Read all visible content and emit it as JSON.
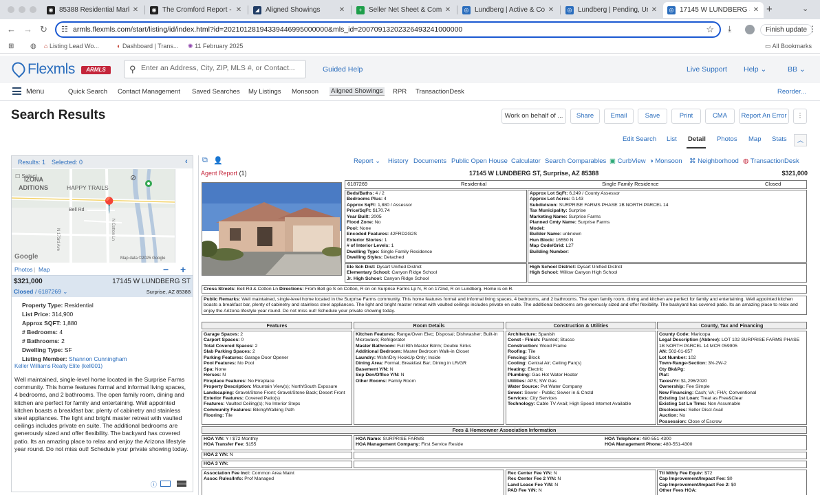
{
  "browser": {
    "tabs": [
      {
        "label": "85388 Residential Market",
        "fav_color": "#222222",
        "fav_glyph": "◉"
      },
      {
        "label": "The Cromford Report - Cro",
        "fav_color": "#222222",
        "fav_glyph": "◉"
      },
      {
        "label": "Aligned Showings",
        "fav_color": "#1f3b64",
        "fav_glyph": "◢"
      },
      {
        "label": "Seller Net Sheet & Compa",
        "fav_color": "#1e9e4a",
        "fav_glyph": "+"
      },
      {
        "label": "Lundberg | Active & Comi",
        "fav_color": "#2a6dbd",
        "fav_glyph": "◎"
      },
      {
        "label": "Lundberg | Pending, Unde",
        "fav_color": "#2a6dbd",
        "fav_glyph": "◎"
      },
      {
        "label": "17145 W LUNDBERG ST, S",
        "fav_color": "#2a6dbd",
        "fav_glyph": "◎"
      }
    ],
    "url": "armls.flexmls.com/start/listing/id/index.html?id=20210128194339446995000000&mls_id=20070913202326493241000000",
    "finish_update": "Finish update",
    "bookmarks": [
      "Listing Lead Wo...",
      "Dashboard | Trans...",
      "11 February 2025"
    ],
    "all_bookmarks": "All Bookmarks"
  },
  "app": {
    "logo": "Flexmls",
    "badge": "ARMLS",
    "search_placeholder": "Enter an Address, City, ZIP, MLS #, or Contact...",
    "guided_help": "Guided Help",
    "live_support": "Live Support",
    "help": "Help",
    "user": "BB",
    "menu_label": "Menu",
    "menu_items": [
      "Quick Search",
      "Contact Management",
      "Saved Searches",
      "My Listings",
      "Monsoon",
      "Aligned Showings",
      "RPR",
      "TransactionDesk"
    ],
    "reorder": "Reorder..."
  },
  "page": {
    "title": "Search Results",
    "actions": [
      "Work on behalf of ...",
      "Share",
      "Email",
      "Save",
      "Print",
      "CMA",
      "Report An Error"
    ],
    "view_tabs": [
      "Edit Search",
      "List",
      "Detail",
      "Photos",
      "Map",
      "Stats"
    ],
    "active_view": "Detail"
  },
  "left": {
    "results": "Results: 1",
    "selected": "Selected: 0",
    "select_label": "Select",
    "map_labels": [
      "IZONA",
      "ADITIONS",
      "HAPPY TRAILS",
      "Bell Rd",
      "N 173rd Ave",
      "N Cotton Ln"
    ],
    "google": "Google",
    "map_data": "Map data ©2025 Google",
    "photos_link": "Photos",
    "map_link": "Map",
    "price": "$321,000",
    "address": "17145 W LUNDBERG ST",
    "status": "Closed",
    "mls": "6187269",
    "city": "Surprise, AZ 85388",
    "facts": [
      {
        "k": "Property Type:",
        "v": "Residential"
      },
      {
        "k": "List Price:",
        "v": "314,900"
      },
      {
        "k": "Approx SQFT:",
        "v": "1,880"
      },
      {
        "k": "# Bedrooms:",
        "v": "4"
      },
      {
        "k": "# Bathrooms:",
        "v": "2"
      },
      {
        "k": "Dwelling Type:",
        "v": "SF"
      },
      {
        "k": "Listing Member:",
        "v": "Shannon Cunningham"
      }
    ],
    "office": "Keller Williams Realty Elite (kell001)",
    "remarks": "Well maintained, single-level home located in the Surprise Farms community. This home features formal and informal living spaces, 4 bedrooms, and 2 bathrooms. The open family room, dining and kitchen are perfect for family and entertaining. Well appointed kitchen boasts a breakfast bar, plenty of cabinetry and stainless steel appliances. The light and bright master retreat with vaulted ceilings includes private en suite. The additional bedrooms are generously sized and offer flexibility. The backyard has covered patio. Its an amazing place to relax and enjoy the Arizona lifestyle year round. Do not miss out! Schedule your private showing today."
  },
  "right": {
    "toolbar": [
      "Report",
      "History",
      "Documents",
      "Public Open House",
      "Calculator",
      "Search Comparables",
      "CurbView",
      "Monsoon",
      "Neighborhood",
      "TransactionDesk"
    ],
    "agent_report": "Agent Report",
    "agent_report_count": "(1)",
    "header_address": "17145 W LUNDBERG ST, Surprise, AZ 85388",
    "header_price": "$321,000",
    "info_row": [
      "6187269",
      "Residential",
      "Single Family Residence",
      "Closed"
    ],
    "col1": [
      {
        "k": "Beds/Baths:",
        "v": "4 / 2"
      },
      {
        "k": "Bedrooms Plus:",
        "v": "4"
      },
      {
        "k": "Approx SqFt:",
        "v": "1,880 / Assessor"
      },
      {
        "k": "Price/SqFt:",
        "v": "$170.74"
      },
      {
        "k": "Year Built:",
        "v": "2005"
      },
      {
        "k": "Flood Zone:",
        "v": "No"
      },
      {
        "k": "Pool:",
        "v": "None"
      },
      {
        "k": "Encoded Features:",
        "v": "42FRD2G2S"
      },
      {
        "k": "Exterior Stories:",
        "v": "1"
      },
      {
        "k": "# of Interior Levels:",
        "v": "1"
      },
      {
        "k": "Dwelling Type:",
        "v": "Single Family Residence"
      },
      {
        "k": "Dwelling Styles:",
        "v": "Detached"
      }
    ],
    "col2": [
      {
        "k": "Approx Lot SqFt:",
        "v": "6,249 / County Assessor"
      },
      {
        "k": "Approx Lot Acres:",
        "v": "0.143"
      },
      {
        "k": "Subdivision:",
        "v": "SURPRISE FARMS PHASE 1B NORTH PARCEL 14"
      },
      {
        "k": "Tax Municipality:",
        "v": "Surprise"
      },
      {
        "k": "Marketing Name:",
        "v": "Surprise Farms"
      },
      {
        "k": "Planned Cmty Name:",
        "v": "Surprise Farms"
      },
      {
        "k": "Model:",
        "v": ""
      },
      {
        "k": "Builder Name:",
        "v": "unknown"
      },
      {
        "k": "Hun Block:",
        "v": "16550 N"
      },
      {
        "k": "Map Code/Grid:",
        "v": "L27"
      },
      {
        "k": "Building Number:",
        "v": ""
      }
    ],
    "schools1": [
      {
        "k": "Ele Sch Dist:",
        "v": "Dysart Unified District"
      },
      {
        "k": "Elementary School:",
        "v": "Canyon Ridge School"
      },
      {
        "k": "Jr. High School:",
        "v": "Canyon Ridge School"
      }
    ],
    "schools2": [
      {
        "k": "High School District:",
        "v": "Dysart Unified District"
      },
      {
        "k": "High School:",
        "v": "Willow Canyon High School"
      }
    ],
    "cross_streets_label": "Cross Streets:",
    "cross_streets": "Bell Rd & Cotton Ln",
    "directions_label": "Directions:",
    "directions": "From Bell go S on Cotton, R on on Surprise Farms Lp N, R on 172nd, R on Lundberg. Home is on R.",
    "public_remarks_label": "Public Remarks:",
    "public_remarks": "Well maintained, single-level home located in the Surprise Farms community. This home features formal and informal living spaces, 4 bedrooms, and 2 bathrooms. The open family room, dining and kitchen are perfect for family and entertaining. Well appointed kitchen boasts a breakfast bar, plenty of cabinetry and stainless steel appliances. The light and bright master retreat with vaulted ceilings includes private en suite. The additional bedrooms are generously sized and offer flexibility. The backyard has covered patio. Its an amazing place to relax and enjoy the Arizona lifestyle year round. Do not miss out! Schedule your private showing today.",
    "sections": [
      "Features",
      "Room Details",
      "Construction & Utilities",
      "County, Tax and Financing"
    ],
    "features": [
      {
        "k": "Garage Spaces:",
        "v": "2"
      },
      {
        "k": "Carport Spaces:",
        "v": "0"
      },
      {
        "k": "Total Covered Spaces:",
        "v": "2"
      },
      {
        "k": "Slab Parking Spaces:",
        "v": "2"
      },
      {
        "k": "Parking Features:",
        "v": "Garage Door Opener"
      },
      {
        "k": "Pool Features:",
        "v": "No Pool"
      },
      {
        "k": "Spa:",
        "v": "None"
      },
      {
        "k": "Horses:",
        "v": "N"
      },
      {
        "k": "Fireplace Features:",
        "v": "No Fireplace"
      },
      {
        "k": "Property Description:",
        "v": "Mountain View(s); North/South Exposure"
      },
      {
        "k": "Landscaping:",
        "v": "Gravel/Stone Front; Gravel/Stone Back; Desert Front"
      },
      {
        "k": "Exterior Features:",
        "v": "Covered Patio(s)"
      },
      {
        "k": "Features:",
        "v": "Vaulted Ceiling(s); No Interior Steps"
      },
      {
        "k": "Community Features:",
        "v": "Biking/Walking Path"
      },
      {
        "k": "Flooring:",
        "v": "Tile"
      }
    ],
    "rooms": [
      {
        "k": "Kitchen Features:",
        "v": "Range/Oven Elec; Disposal; Dishwasher; Built-in Microwave; Refrigerator"
      },
      {
        "k": "Master Bathroom:",
        "v": "Full Bth Master Bdrm; Double Sinks"
      },
      {
        "k": "Additional Bedroom:",
        "v": "Master Bedroom Walk-in Closet"
      },
      {
        "k": "Laundry:",
        "v": "Wshr/Dry HookUp Only; Inside"
      },
      {
        "k": "Dining Area:",
        "v": "Formal; Breakfast Bar; Dining in LR/GR"
      },
      {
        "k": "Basement Y/N:",
        "v": "N"
      },
      {
        "k": "Sep Den/Office Y/N:",
        "v": "N"
      },
      {
        "k": "Other Rooms:",
        "v": "Family Room"
      }
    ],
    "construction": [
      {
        "k": "Architecture:",
        "v": "Spanish"
      },
      {
        "k": "Const - Finish:",
        "v": "Painted; Stucco"
      },
      {
        "k": "Construction:",
        "v": "Wood Frame"
      },
      {
        "k": "Roofing:",
        "v": "Tile"
      },
      {
        "k": "Fencing:",
        "v": "Block"
      },
      {
        "k": "Cooling:",
        "v": "Central Air; Ceiling Fan(s)"
      },
      {
        "k": "Heating:",
        "v": "Electric"
      },
      {
        "k": "Plumbing:",
        "v": "Gas Hot Water Heater"
      },
      {
        "k": "Utilities:",
        "v": "APS; SW Gas"
      },
      {
        "k": "Water Source:",
        "v": "Pvt Water Company"
      },
      {
        "k": "Sewer:",
        "v": "Sewer - Public; Sewer in & Cnctd"
      },
      {
        "k": "Services:",
        "v": "City Services"
      },
      {
        "k": "Technology:",
        "v": "Cable TV Avail; High Speed Internet Available"
      }
    ],
    "county": [
      {
        "k": "County Code:",
        "v": "Maricopa"
      },
      {
        "k": "Legal Description (Abbrev):",
        "v": "LOT 102 SURPRISE FARMS PHASE 1B NORTH PARCEL 14 MCR 059905"
      },
      {
        "k": "AN:",
        "v": "502-01-657"
      },
      {
        "k": "Lot Number:",
        "v": "102"
      },
      {
        "k": "Town-Range-Section:",
        "v": "3N-2W-2"
      },
      {
        "k": "Cty Bk&Pg:",
        "v": ""
      },
      {
        "k": "Plat:",
        "v": ""
      },
      {
        "k": "Taxes/Yr:",
        "v": "$1,296/2020"
      },
      {
        "k": "Ownership:",
        "v": "Fee Simple"
      },
      {
        "k": "New Financing:",
        "v": "Cash; VA; FHA; Conventional"
      },
      {
        "k": "Existing 1st Loan:",
        "v": "Treat as Free&Clear"
      },
      {
        "k": "Existing 1st Ln Trms:",
        "v": "Non Assumable"
      },
      {
        "k": "Disclosures:",
        "v": "Seller Discl Avail"
      },
      {
        "k": "Auction:",
        "v": "No"
      },
      {
        "k": "Possession:",
        "v": "Close of Escrow"
      }
    ],
    "fees_header": "Fees & Homeowner Association Information",
    "hoa_a": [
      {
        "k": "HOA Y/N:",
        "v": "Y / $72 Monthly"
      },
      {
        "k": "HOA Transfer Fee:",
        "v": "$155"
      }
    ],
    "hoa_b": [
      {
        "k": "HOA Name:",
        "v": "SURPRISE FARMS"
      },
      {
        "k": "HOA Management Company:",
        "v": "First Service Reside"
      }
    ],
    "hoa_c": [
      {
        "k": "HOA Telephone:",
        "v": "480-551-4300"
      },
      {
        "k": "HOA Management Phone:",
        "v": "480-551-4300"
      }
    ],
    "hoa2": {
      "k": "HOA 2 Y/N:",
      "v": "N"
    },
    "hoa3": {
      "k": "HOA 3 Y/N:",
      "v": ""
    },
    "assoc": [
      {
        "k": "Association Fee Incl:",
        "v": "Common Area Maint"
      },
      {
        "k": "Assoc Rules/Info:",
        "v": "Prof Managed"
      }
    ],
    "rec": [
      {
        "k": "Rec Center Fee Y/N:",
        "v": "N"
      },
      {
        "k": "Rec Center Fee 2 Y/N:",
        "v": "N"
      },
      {
        "k": "Land Lease Fee Y/N:",
        "v": "N"
      },
      {
        "k": "PAD Fee Y/N:",
        "v": "N"
      }
    ],
    "ttl": [
      {
        "k": "Ttl Mthly Fee Equiv:",
        "v": "$72"
      },
      {
        "k": "Cap Improvement/Impact Fee:",
        "v": "$0"
      },
      {
        "k": "Cap Improvement/Impact Fee 2:",
        "v": "$0"
      },
      {
        "k": "Other Fees HOA:",
        "v": ""
      }
    ]
  }
}
